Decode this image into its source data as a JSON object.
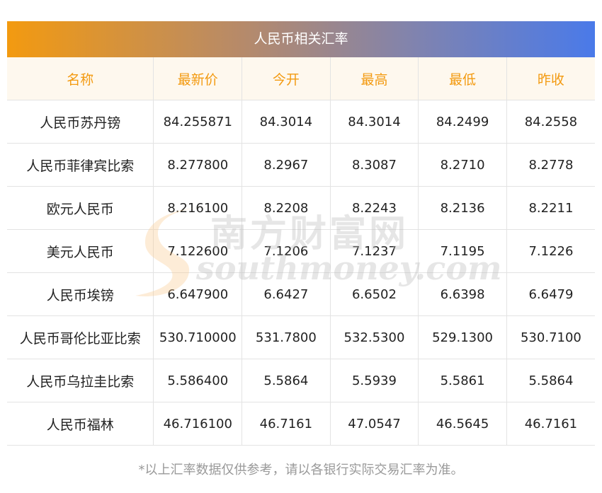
{
  "title": "人民币相关汇率",
  "columns": [
    "名称",
    "最新价",
    "今开",
    "最高",
    "最低",
    "昨收"
  ],
  "rows": [
    [
      "人民币苏丹镑",
      "84.255871",
      "84.3014",
      "84.3014",
      "84.2499",
      "84.2558"
    ],
    [
      "人民币菲律宾比索",
      "8.277800",
      "8.2967",
      "8.3087",
      "8.2710",
      "8.2778"
    ],
    [
      "欧元人民币",
      "8.216100",
      "8.2208",
      "8.2243",
      "8.2136",
      "8.2211"
    ],
    [
      "美元人民币",
      "7.122600",
      "7.1206",
      "7.1237",
      "7.1195",
      "7.1226"
    ],
    [
      "人民币埃镑",
      "6.647900",
      "6.6427",
      "6.6502",
      "6.6398",
      "6.6479"
    ],
    [
      "人民币哥伦比亚比索",
      "530.710000",
      "531.7800",
      "532.5300",
      "529.1300",
      "530.7100"
    ],
    [
      "人民币乌拉圭比索",
      "5.586400",
      "5.5864",
      "5.5939",
      "5.5861",
      "5.5864"
    ],
    [
      "人民币福林",
      "46.716100",
      "46.7161",
      "47.0547",
      "46.5645",
      "46.7161"
    ]
  ],
  "footer": "*以上汇率数据仅供参考，请以各银行实际交易汇率为准。",
  "watermark": {
    "cn": "南方财富网",
    "en": "southmoney.com"
  },
  "colors": {
    "header_text": "#f39a10",
    "header_bg": "#fef8ee",
    "title_gradient_start": "#f39a10",
    "title_gradient_end": "#4a7ae9"
  }
}
